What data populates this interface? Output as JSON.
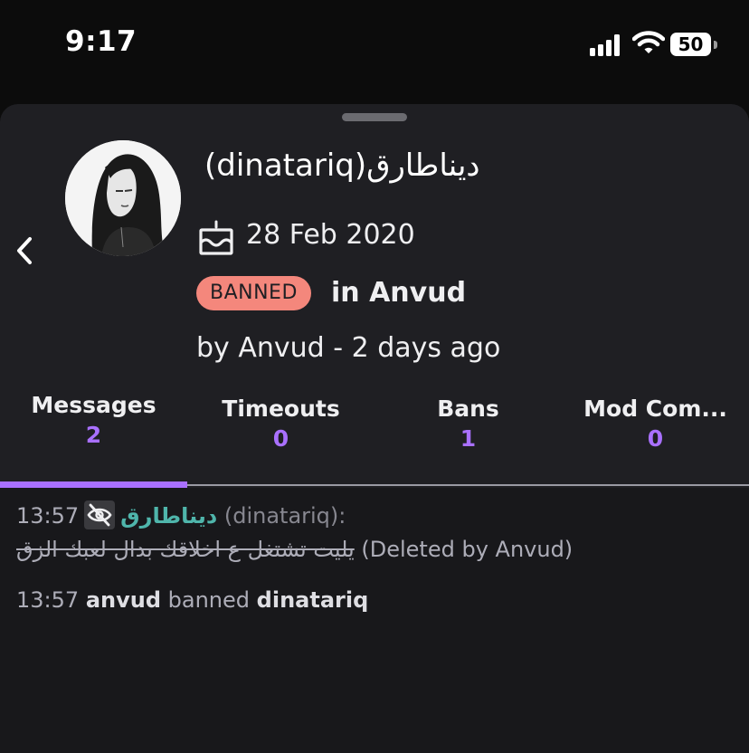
{
  "status_bar": {
    "time": "9:17",
    "battery": "50"
  },
  "user": {
    "display_name": "(dinatariq)ديناطارق",
    "created": "28 Feb 2020"
  },
  "ban": {
    "badge": "BANNED",
    "channel": "in Anvud",
    "meta": "by Anvud - 2 days ago"
  },
  "tabs": [
    {
      "label": "Messages",
      "count": "2"
    },
    {
      "label": "Timeouts",
      "count": "0"
    },
    {
      "label": "Bans",
      "count": "1"
    },
    {
      "label": "Mod Com...",
      "count": "0"
    }
  ],
  "log": {
    "message": {
      "time": "13:57",
      "username": "ديناطارق",
      "login": "(dinatariq):",
      "text": "يليت تشتغل ع اخلاقك بدال لعبك الزق",
      "deleted_note": "(Deleted by Anvud)"
    },
    "event": {
      "time": "13:57",
      "actor": "anvud",
      "action": "banned",
      "target": "dinatariq"
    }
  },
  "colors": {
    "accent": "#a970ff",
    "banned": "#f4877c",
    "username": "#4fb5ab"
  }
}
